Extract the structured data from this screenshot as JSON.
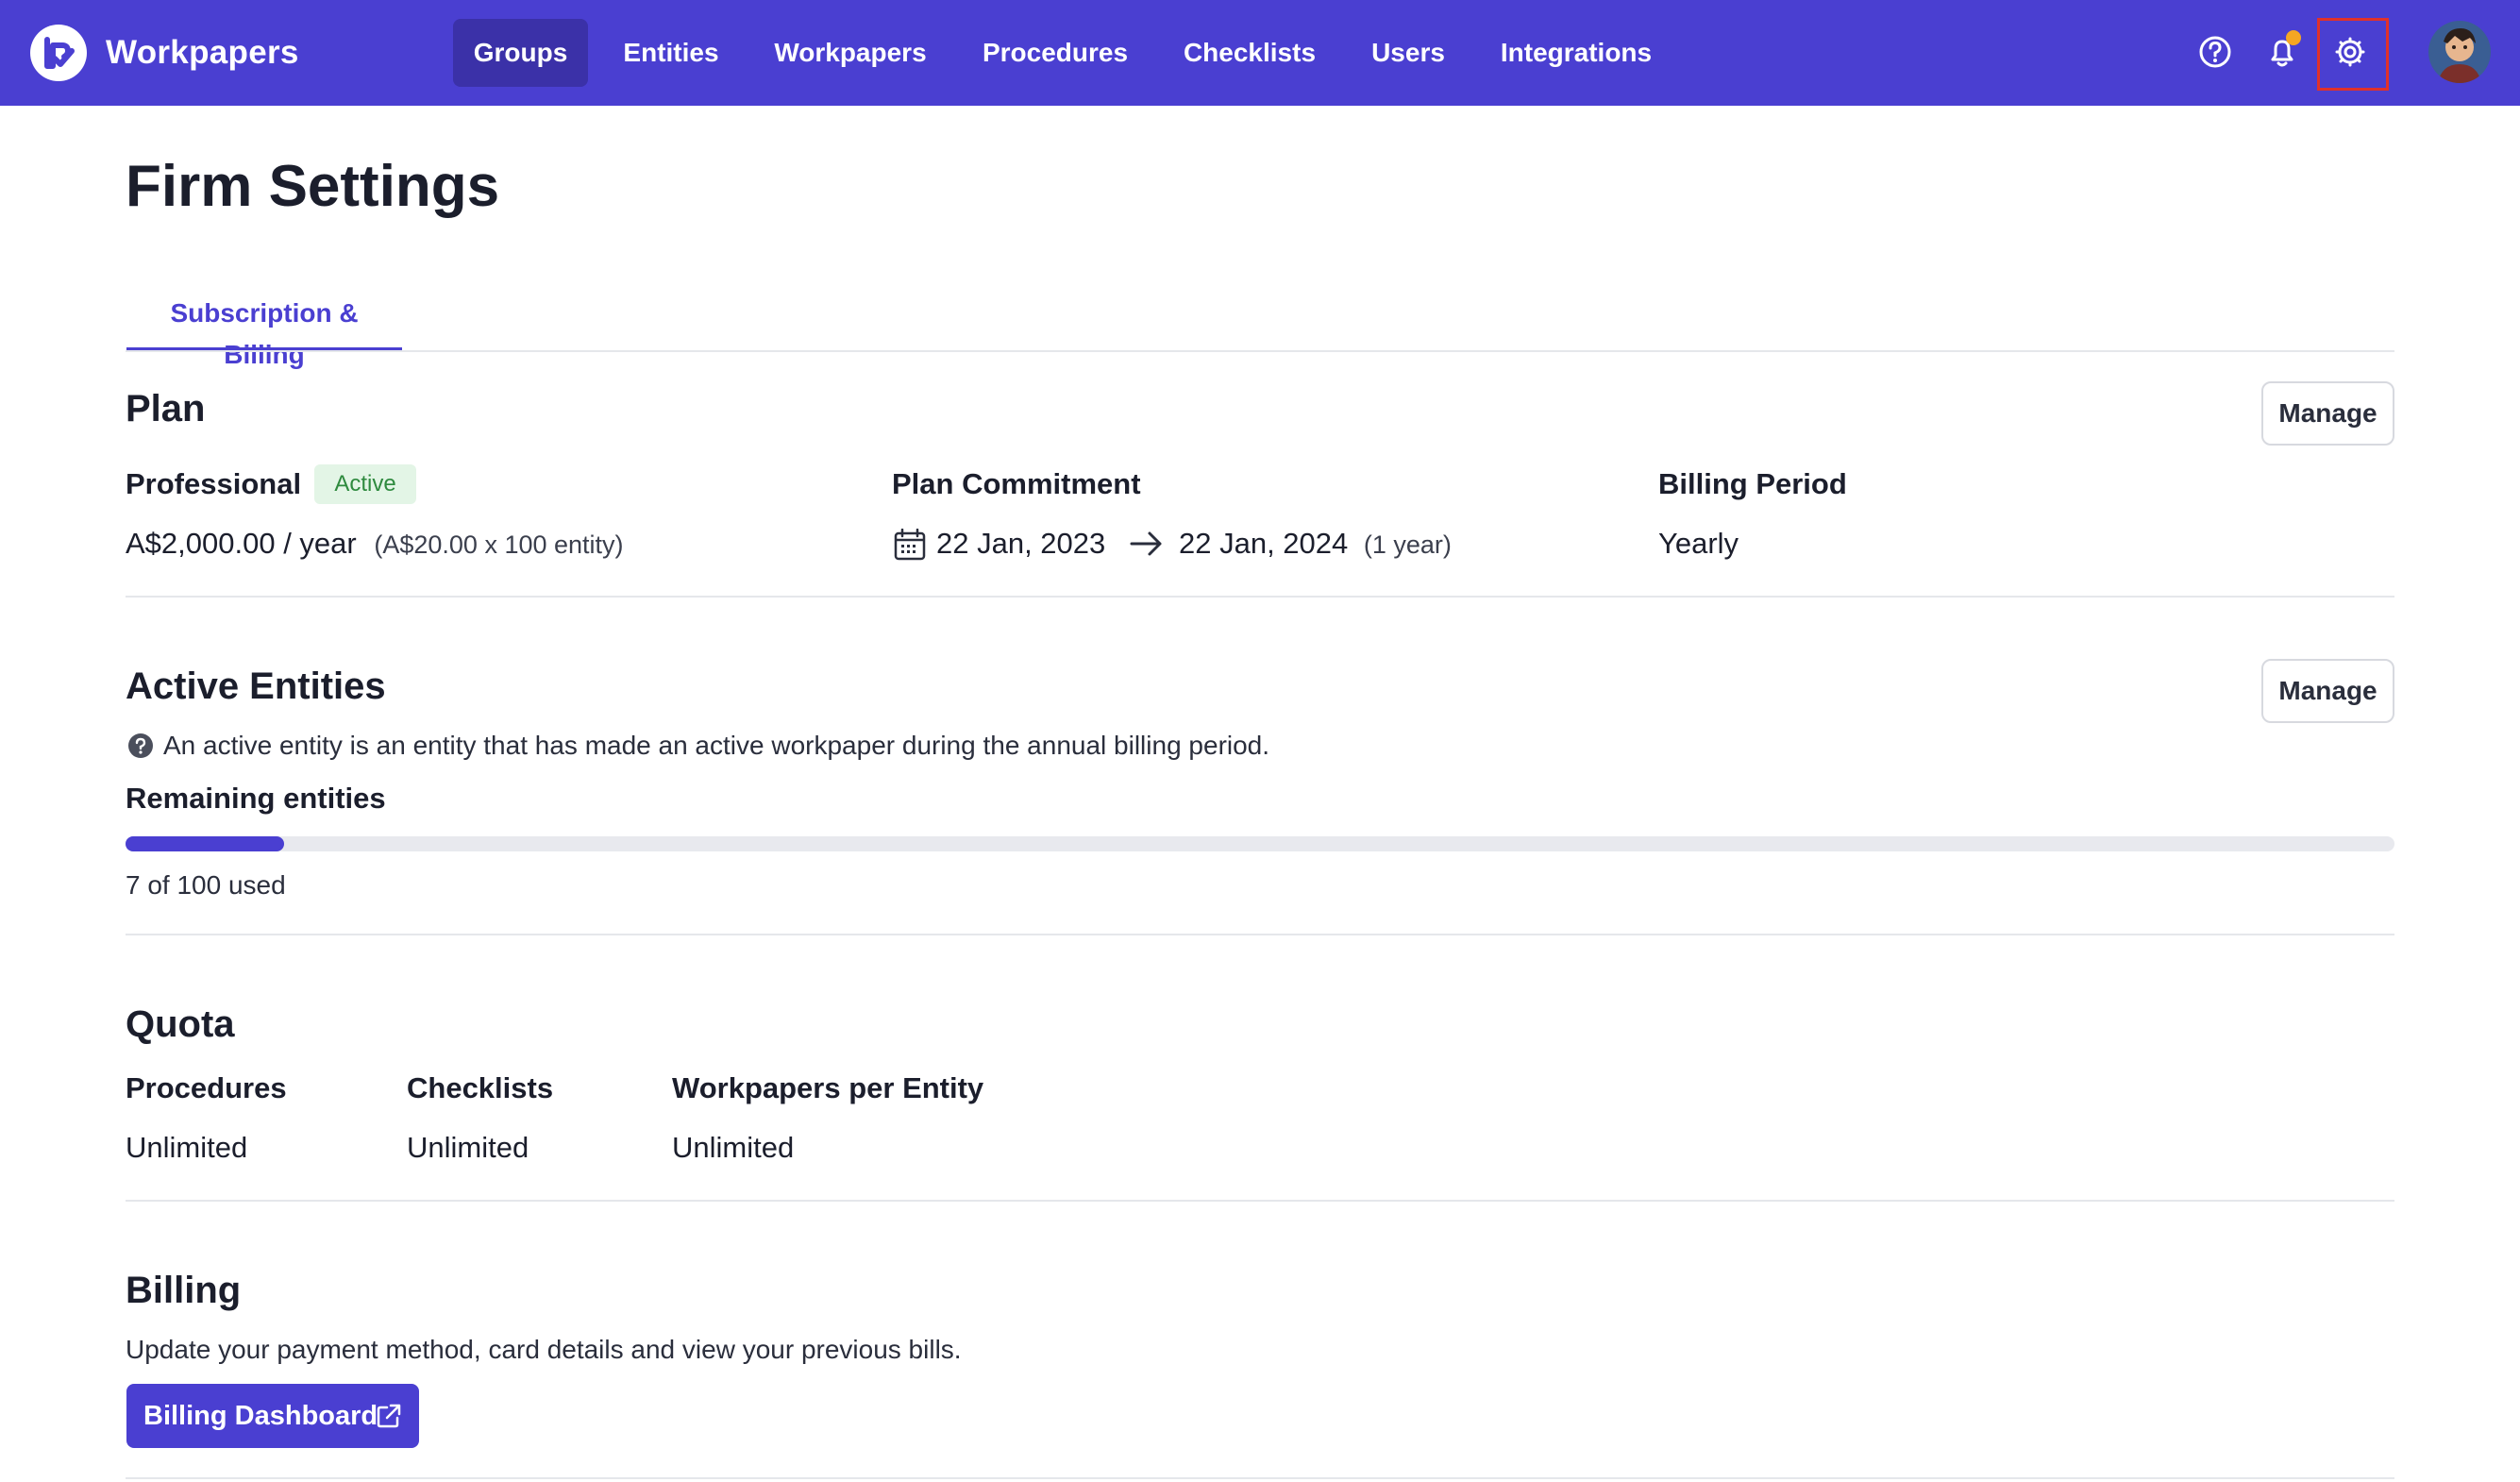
{
  "app": {
    "brand": "Workpapers"
  },
  "nav": {
    "items": [
      {
        "label": "Groups",
        "active": true
      },
      {
        "label": "Entities",
        "active": false
      },
      {
        "label": "Workpapers",
        "active": false
      },
      {
        "label": "Procedures",
        "active": false
      },
      {
        "label": "Checklists",
        "active": false
      },
      {
        "label": "Users",
        "active": false
      },
      {
        "label": "Integrations",
        "active": false
      }
    ],
    "icons": [
      "help-icon",
      "bell-icon",
      "gear-icon"
    ]
  },
  "colors": {
    "brand": "#4a3fd1",
    "brand_dark": "#3b31a8",
    "active_badge_bg": "#e3f5e6",
    "active_badge_text": "#2e8a3e",
    "notification": "#f5a623",
    "highlight": "#e0312b"
  },
  "page": {
    "title": "Firm Settings"
  },
  "tabs": [
    {
      "label": "Subscription & Billing",
      "active": true
    }
  ],
  "plan": {
    "title": "Plan",
    "manage_label": "Manage",
    "name": "Professional",
    "status": "Active",
    "price": "A$2,000.00 / year",
    "price_detail": "(A$20.00 x 100 entity)",
    "commitment_label": "Plan Commitment",
    "commitment_start": "22 Jan, 2023",
    "commitment_end": "22 Jan, 2024",
    "commitment_duration": "(1 year)",
    "billing_period_label": "Billing Period",
    "billing_period": "Yearly"
  },
  "active_entities": {
    "title": "Active Entities",
    "manage_label": "Manage",
    "info": "An active entity is an entity that has made an active workpaper during the annual billing period.",
    "remaining_label": "Remaining entities",
    "used": 7,
    "total": 100,
    "usage_text": "7 of 100 used"
  },
  "quota": {
    "title": "Quota",
    "items": [
      {
        "label": "Procedures",
        "value": "Unlimited"
      },
      {
        "label": "Checklists",
        "value": "Unlimited"
      },
      {
        "label": "Workpapers per Entity",
        "value": "Unlimited"
      }
    ]
  },
  "billing": {
    "title": "Billing",
    "description": "Update your payment method, card details and view your previous bills.",
    "button_label": "Billing Dashboard"
  }
}
